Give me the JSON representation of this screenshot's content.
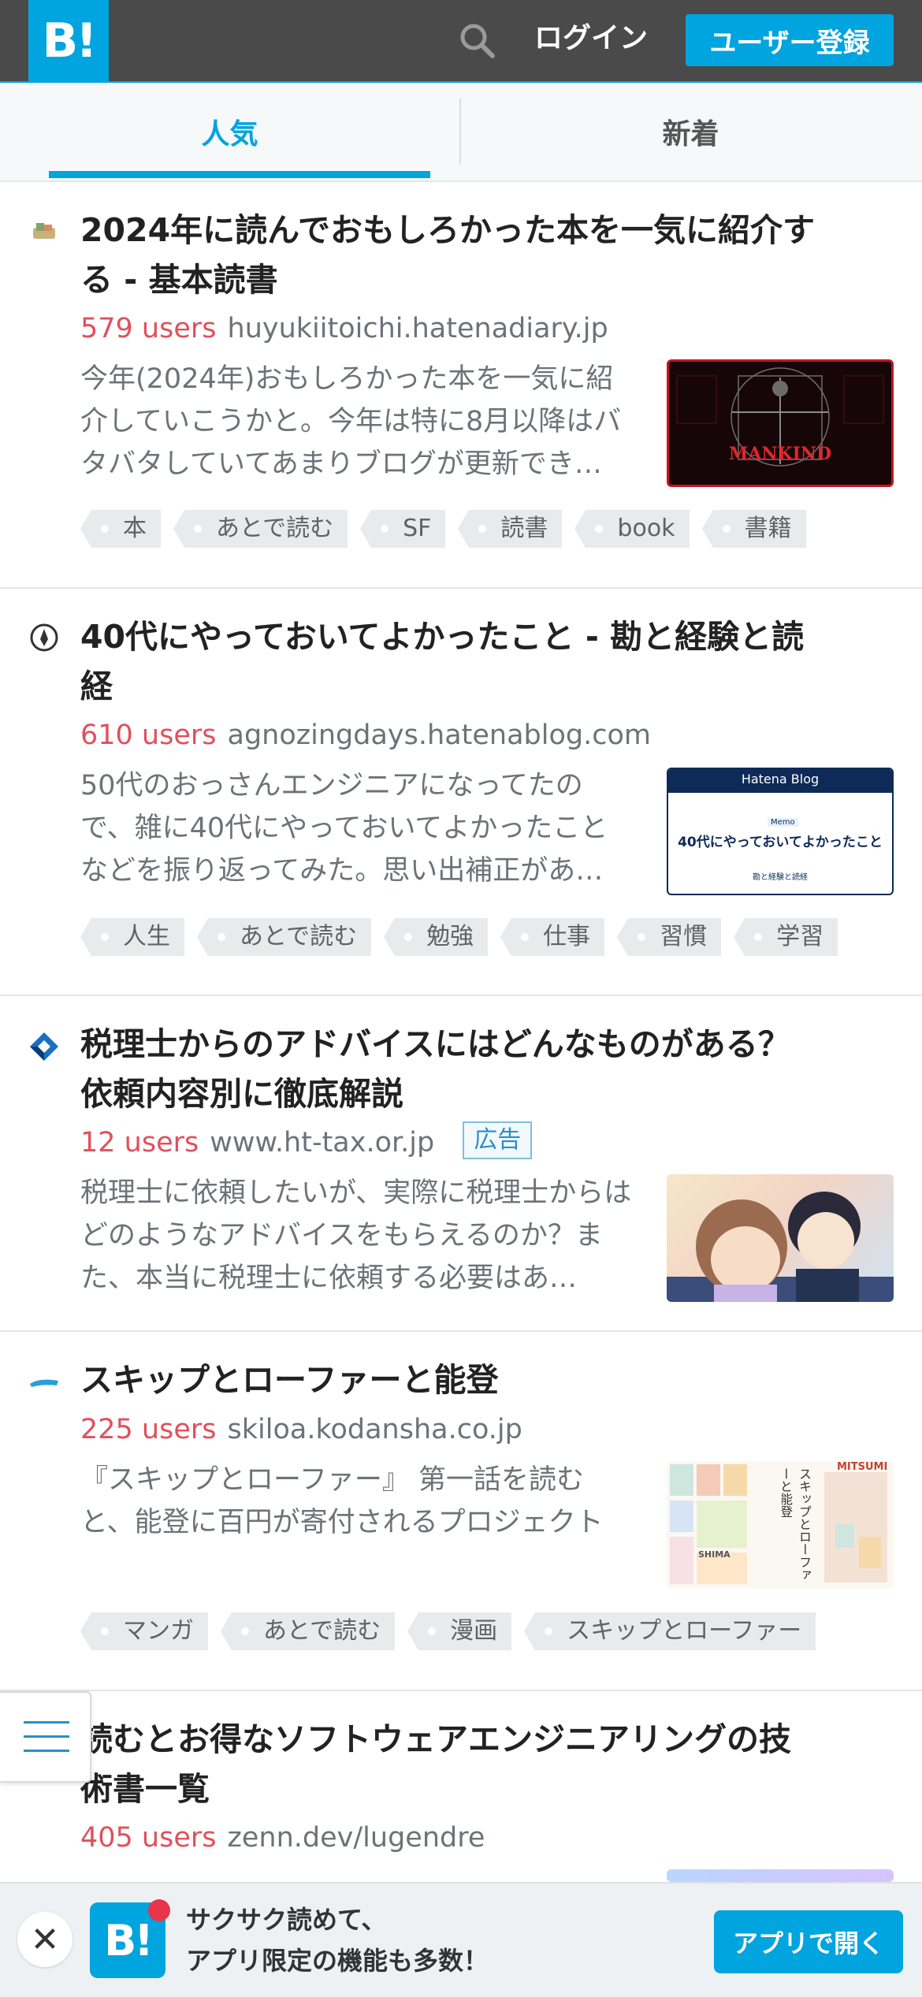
{
  "header": {
    "logo_text": "B!",
    "login_label": "ログイン",
    "signup_label": "ユーザー登録"
  },
  "tabs": [
    {
      "label": "人気",
      "active": true
    },
    {
      "label": "新着",
      "active": false
    }
  ],
  "entries": [
    {
      "title": "2024年に読んでおもしろかった本を一気に紹介する - 基本読書",
      "users": "579 users",
      "domain": "huyukiitoichi.hatenadiary.jp",
      "description": "今年(2024年)おもしろかった本を一気に紹介していこうかと。今年は特に8月以降はバタバタしていてあまりブログが更新でき…",
      "tags": [
        "本",
        "あとで読む",
        "SF",
        "読書",
        "book",
        "書籍"
      ],
      "thumbnail_text": "MANKIND"
    },
    {
      "title": "40代にやっておいてよかったこと - 勘と経験と読経",
      "users": "610 users",
      "domain": "agnozingdays.hatenablog.com",
      "description": "50代のおっさんエンジニアになってたので、雑に40代にやっておいてよかったことなどを振り返ってみた。思い出補正があ…",
      "tags": [
        "人生",
        "あとで読む",
        "勉強",
        "仕事",
        "習慣",
        "学習"
      ],
      "thumbnail_text": {
        "brand": "Hatena Blog",
        "badge": "Memo",
        "headline": "40代にやっておいてよかったこと",
        "sub": "勘と経験と読経"
      }
    },
    {
      "title": "税理士からのアドバイスにはどんなものがある？依頼内容別に徹底解説",
      "users": "12 users",
      "domain": "www.ht-tax.or.jp",
      "ad_label": "広告",
      "description": "税理士に依頼したいが、実際に税理士からはどのようなアドバイスをもらえるのか？また、本当に税理士に依頼する必要はあ…",
      "tags": []
    },
    {
      "title": "スキップとローファーと能登",
      "users": "225 users",
      "domain": "skiloa.kodansha.co.jp",
      "description": "『スキップとローファー』 第一話を読むと、能登に百円が寄付されるプロジェクト",
      "tags": [
        "マンガ",
        "あとで読む",
        "漫画",
        "スキップとローファー"
      ],
      "thumbnail_text": {
        "vertical": "スキップとローファーと能登",
        "brand": "MITSUMI",
        "label": "SHIMA"
      }
    },
    {
      "title": "読むとお得なソフトウェアエンジニアリングの技術書一覧",
      "users": "405 users",
      "domain": "zenn.dev/lugendre",
      "description": "",
      "tags": []
    }
  ],
  "banner": {
    "app_icon_text": "B!",
    "line1": "サクサク読めて、",
    "line2": "アプリ限定の機能も多数！",
    "open_label": "アプリで開く",
    "close_glyph": "✕"
  },
  "colors": {
    "accent": "#00a4de",
    "header_bg": "#4a4a4a",
    "users": "#e0505c"
  }
}
